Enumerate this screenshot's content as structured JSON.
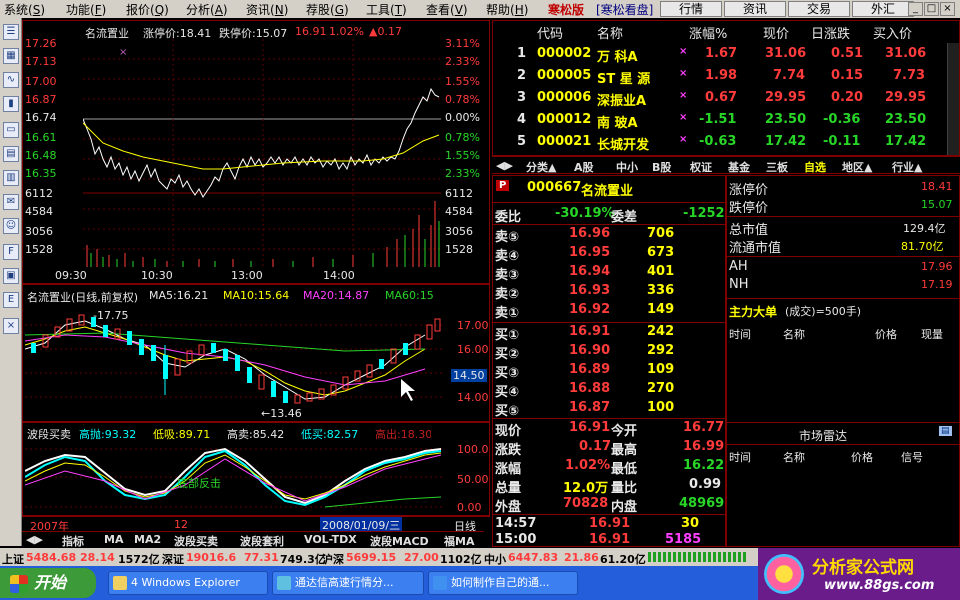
{
  "menu": [
    {
      "label": "系统",
      "key": "S"
    },
    {
      "label": "功能",
      "key": "F"
    },
    {
      "label": "报价",
      "key": "Q"
    },
    {
      "label": "分析",
      "key": "A"
    },
    {
      "label": "资讯",
      "key": "N"
    },
    {
      "label": "荐股",
      "key": "G"
    },
    {
      "label": "工具",
      "key": "T"
    },
    {
      "label": "查看",
      "key": "V"
    },
    {
      "label": "帮助",
      "key": "H"
    }
  ],
  "brand": "寒松版",
  "brand2": "[寒松看盘]",
  "top_buttons": [
    "行情",
    "资讯",
    "交易",
    "外汇"
  ],
  "intraday": {
    "title": "名流置业",
    "limit_up_label": "涨停价:18.41",
    "limit_down_label": "跌停价:15.07",
    "last": "16.91",
    "pct": "1.02%",
    "chg": "▲0.17",
    "y_left": [
      "17.26",
      "17.13",
      "17.00",
      "16.87",
      "16.74",
      "16.61",
      "16.48",
      "16.35"
    ],
    "y_right": [
      "3.11%",
      "2.33%",
      "1.55%",
      "0.78%",
      "0.00%",
      "0.78%",
      "1.55%",
      "2.33%"
    ],
    "vol_left": [
      "6112",
      "4584",
      "3056",
      "1528"
    ],
    "vol_right": [
      "6112",
      "4584",
      "3056",
      "1528"
    ],
    "x_labels": [
      "09:30",
      "10:30",
      "13:00",
      "14:00"
    ]
  },
  "kline": {
    "title": "名流置业(日线,前复权)",
    "ma5": "MA5:16.21",
    "ma10": "MA10:15.64",
    "ma20": "MA20:14.87",
    "ma60": "MA60:15",
    "high_mark": "17.75",
    "low_mark": "13.46",
    "y_labels": [
      "17.00",
      "16.00",
      "15.00",
      "14.00"
    ],
    "cursor_val": "14.50"
  },
  "indicator": {
    "name": "波段买卖",
    "high_throw": "高抛:93.32",
    "low_suck": "低吸:89.71",
    "high_sell": "高卖:85.42",
    "low_buy": "低买:82.57",
    "high_out": "高出:18.30",
    "y_labels": [
      "100.0",
      "50.00",
      "0.00"
    ],
    "annotation": "底部反击"
  },
  "date_bar": {
    "year": "2007年",
    "month": "12",
    "date": "2008/01/09/三",
    "period": "日线"
  },
  "indicator_tabs": [
    "指标",
    "MA",
    "MA2",
    "波段买卖",
    "波段套利",
    "VOL-TDX",
    "波段MACD",
    "福MA"
  ],
  "quote_list": {
    "headers": [
      "代码",
      "名称",
      "涨幅%",
      "现价",
      "日涨跌",
      "买入价"
    ],
    "rows": [
      {
        "idx": "1",
        "code": "000002",
        "name": "万  科A",
        "pct": "1.67",
        "price": "31.06",
        "chg": "0.51",
        "bid": "31.06",
        "up": true
      },
      {
        "idx": "2",
        "code": "000005",
        "name": "ST 星 源",
        "pct": "1.98",
        "price": "7.74",
        "chg": "0.15",
        "bid": "7.73",
        "up": true
      },
      {
        "idx": "3",
        "code": "000006",
        "name": "深振业A",
        "pct": "0.67",
        "price": "29.95",
        "chg": "0.20",
        "bid": "29.95",
        "up": true
      },
      {
        "idx": "4",
        "code": "000012",
        "name": "南  玻A",
        "pct": "-1.51",
        "price": "23.50",
        "chg": "-0.36",
        "bid": "23.50",
        "up": false
      },
      {
        "idx": "5",
        "code": "000021",
        "name": "长城开发",
        "pct": "-0.63",
        "price": "17.42",
        "chg": "-0.11",
        "bid": "17.42",
        "up": false
      }
    ]
  },
  "categories": [
    "分类▲",
    "A股",
    "中小",
    "B股",
    "权证",
    "基金",
    "三板",
    "自选",
    "地区▲",
    "行业▲"
  ],
  "stock": {
    "code": "000667",
    "name": "名流置业"
  },
  "order_book": {
    "ratio_label": "委比",
    "ratio": "-30.19%",
    "diff_label": "委差",
    "diff": "-1252",
    "asks": [
      {
        "label": "卖⑤",
        "price": "16.96",
        "vol": "706"
      },
      {
        "label": "卖④",
        "price": "16.95",
        "vol": "673"
      },
      {
        "label": "卖③",
        "price": "16.94",
        "vol": "401"
      },
      {
        "label": "卖②",
        "price": "16.93",
        "vol": "336"
      },
      {
        "label": "卖①",
        "price": "16.92",
        "vol": "149"
      }
    ],
    "bids": [
      {
        "label": "买①",
        "price": "16.91",
        "vol": "242"
      },
      {
        "label": "买②",
        "price": "16.90",
        "vol": "292"
      },
      {
        "label": "买③",
        "price": "16.89",
        "vol": "109"
      },
      {
        "label": "买④",
        "price": "16.88",
        "vol": "270"
      },
      {
        "label": "买⑤",
        "price": "16.87",
        "vol": "100"
      }
    ]
  },
  "stats": [
    {
      "l1": "现价",
      "v1": "16.91",
      "l2": "今开",
      "v2": "16.77"
    },
    {
      "l1": "涨跌",
      "v1": "0.17",
      "l2": "最高",
      "v2": "16.99"
    },
    {
      "l1": "涨幅",
      "v1": "1.02%",
      "l2": "最低",
      "v2": "16.22"
    },
    {
      "l1": "总量",
      "v1": "12.0万",
      "l2": "量比",
      "v2": "0.99"
    },
    {
      "l1": "外盘",
      "v1": "70828",
      "l2": "内盘",
      "v2": "48969"
    }
  ],
  "ticks": [
    {
      "time": "14:57",
      "price": "16.91",
      "vol": "30"
    },
    {
      "time": "15:00",
      "price": "16.91",
      "vol": "5185"
    }
  ],
  "info": [
    {
      "label": "涨停价",
      "value": "18.41"
    },
    {
      "label": "跌停价",
      "value": "15.07"
    },
    {
      "label": "总市值",
      "value": "129.4亿"
    },
    {
      "label": "流通市值",
      "value": "81.70亿"
    },
    {
      "label": "AH",
      "value": "17.96"
    },
    {
      "label": "NH",
      "value": "17.19"
    }
  ],
  "big_orders": {
    "title": "主力大单",
    "subtitle": "(成交)=500手)",
    "headers": [
      "时间",
      "名称",
      "价格",
      "现量"
    ]
  },
  "radar": {
    "title": "市场雷达",
    "headers": [
      "时间",
      "名称",
      "价格",
      "信号"
    ]
  },
  "status": [
    {
      "label": "上证",
      "value": "5484.68",
      "chg": "28.14",
      "amt": "1572亿"
    },
    {
      "label": "深证",
      "value": "19016.6",
      "chg": "77.31",
      "amt": "749.3亿"
    },
    {
      "label": "沪深",
      "value": "5699.15",
      "chg": "27.00",
      "amt": "1102亿"
    },
    {
      "label": "中小",
      "value": "6447.83",
      "chg": "21.86",
      "amt": "61.20亿"
    }
  ],
  "taskbar": {
    "start": "开始",
    "tasks": [
      "4 Windows Explorer",
      "通达信高速行情分...",
      "如何制作自己的通..."
    ]
  },
  "logo": {
    "title": "分析家公式网",
    "url": "www.88gs.com"
  },
  "colors": {
    "up": "#ff3b3b",
    "down": "#28d628",
    "frame": "#800000",
    "panel_bg": "#000000"
  }
}
